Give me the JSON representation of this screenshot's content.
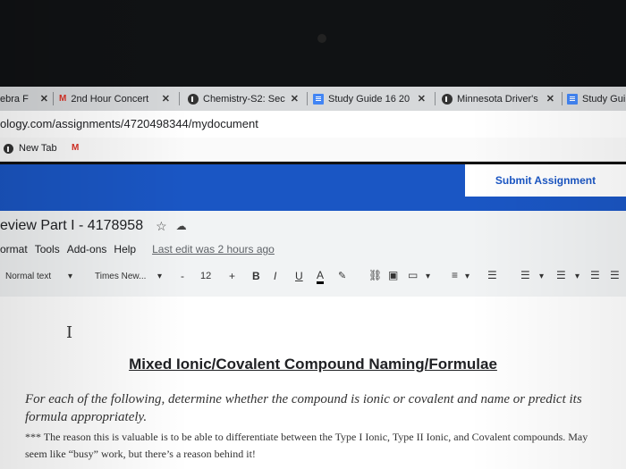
{
  "browser": {
    "tabs": [
      {
        "label": "ebra F",
        "icon": "tab-icon"
      },
      {
        "label": "2nd Hour Concert",
        "icon": "gmail-icon"
      },
      {
        "label": "Chemistry-S2: Sec",
        "icon": "schoology-icon"
      },
      {
        "label": "Study Guide 16 20",
        "icon": "docs-icon"
      },
      {
        "label": "Minnesota Driver's",
        "icon": "globe-icon"
      },
      {
        "label": "Study Gui",
        "icon": "docs-icon"
      }
    ],
    "gmail_glyph": "M",
    "url": "ology.com/assignments/4720498344/mydocument",
    "bookmarks": [
      {
        "label": "New Tab",
        "icon": "globe-icon"
      }
    ],
    "colors": {
      "banner": "#1a56c4",
      "tabstrip": "#d6d8da"
    }
  },
  "assignment": {
    "submit_label": "Submit Assignment"
  },
  "doc": {
    "title": "eview Part I - 4178958",
    "menus": [
      "ormat",
      "Tools",
      "Add-ons",
      "Help"
    ],
    "last_edit": "Last edit was 2 hours ago",
    "toolbar": {
      "style": "Normal text",
      "font": "Times New...",
      "size": "12",
      "minus": "-",
      "plus": "+",
      "bold": "B",
      "italic": "I",
      "underline": "U",
      "text_color": "A"
    },
    "heading": "Mixed Ionic/Covalent Compound Naming/Formulae",
    "instructions": "For each of the following, determine whether the compound is ionic or covalent and name or predict its formula appropriately.",
    "note": "*** The reason this is valuable is to be able to differentiate between the Type I Ionic, Type II Ionic, and Covalent compounds. May seem like “busy” work, but there’s a reason behind it!"
  }
}
